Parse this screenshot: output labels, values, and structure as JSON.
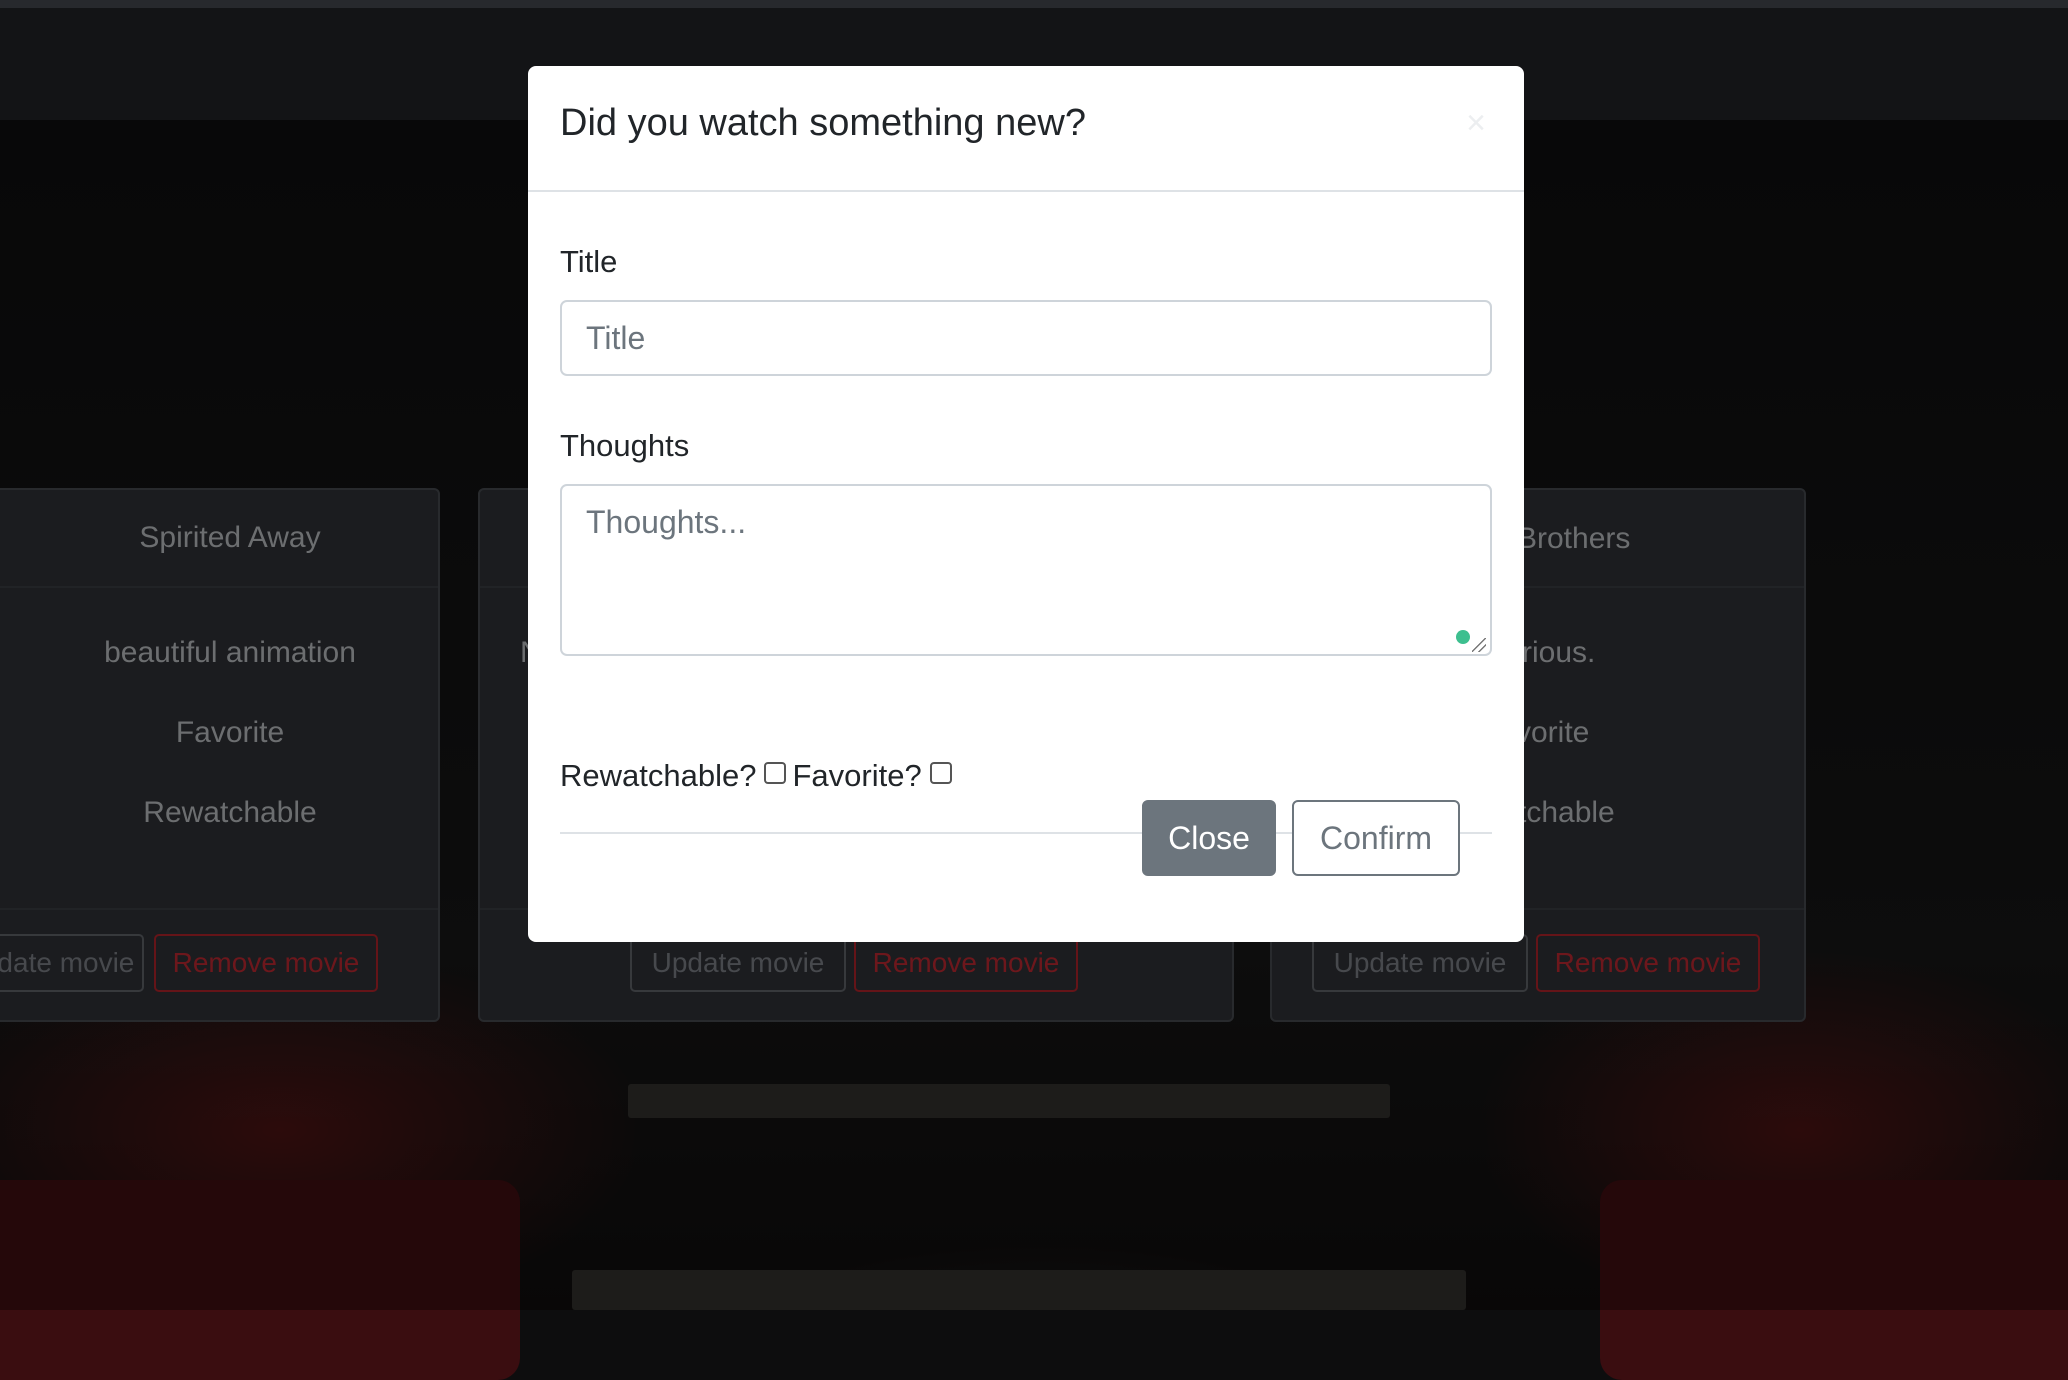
{
  "cards": [
    {
      "title": "Spirited Away",
      "thoughts": "beautiful animation",
      "favorite": "Favorite",
      "rewatchable": "Rewatchable",
      "update_label": "Update movie",
      "remove_label": "Remove movie"
    },
    {
      "title": "",
      "thoughts": "N",
      "favorite": "",
      "rewatchable": "",
      "update_label": "Update movie",
      "remove_label": "Remove movie"
    },
    {
      "title": "Brothers",
      "thoughts": "rious.",
      "favorite": "vorite",
      "rewatchable": "tchable",
      "update_label": "Update movie",
      "remove_label": "Remove movie"
    }
  ],
  "modal": {
    "title": "Did you watch something new?",
    "close_symbol": "×",
    "title_label": "Title",
    "title_placeholder": "Title",
    "thoughts_label": "Thoughts",
    "thoughts_placeholder": "Thoughts...",
    "rewatchable_label": "Rewatchable?",
    "favorite_label": "Favorite?",
    "close_button": "Close",
    "confirm_button": "Confirm"
  },
  "colors": {
    "remove_button": "#a8242c",
    "secondary_button": "#6c757d",
    "status_dot": "#3dbf8f"
  }
}
